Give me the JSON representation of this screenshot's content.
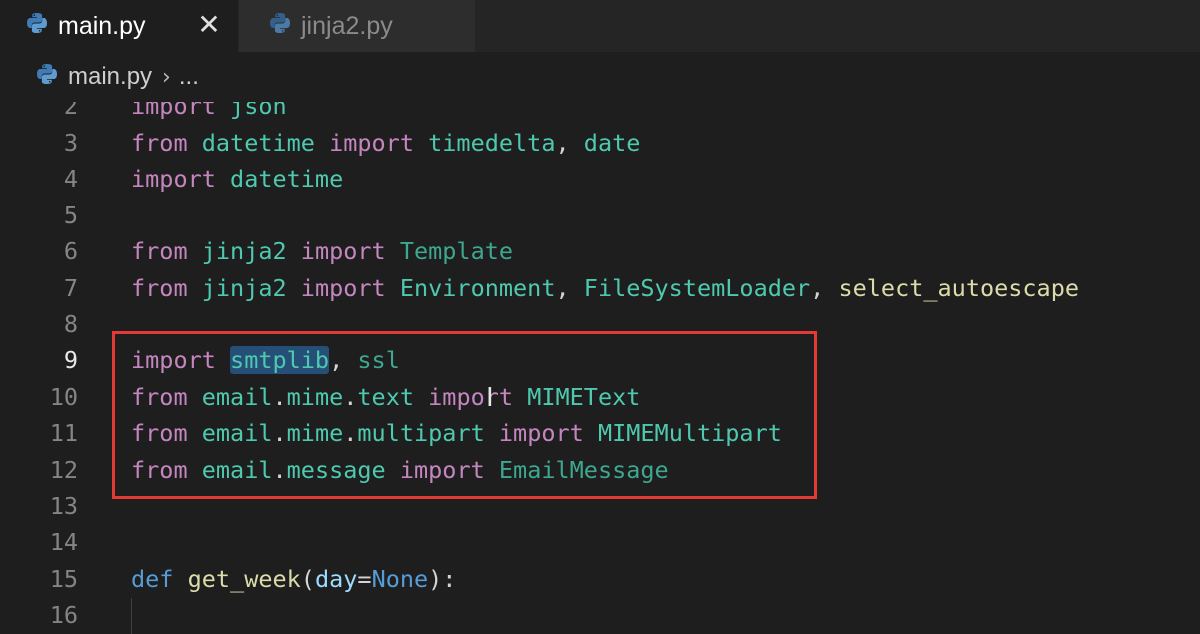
{
  "tabs": [
    {
      "label": "main.py",
      "active": true
    },
    {
      "label": "jinja2.py",
      "active": false
    }
  ],
  "close_glyph": "✕",
  "breadcrumb": {
    "file": "main.py",
    "separator": "›",
    "more": "..."
  },
  "editor": {
    "current_line": "9",
    "line_numbers": [
      "2",
      "3",
      "4",
      "5",
      "6",
      "7",
      "8",
      "9",
      "10",
      "11",
      "12",
      "13",
      "14",
      "15",
      "16"
    ],
    "lines": {
      "l2": {
        "kw": "import",
        "mod": "json"
      },
      "l3": {
        "kw1": "from",
        "mod": "datetime",
        "kw2": "import",
        "a": "timedelta",
        "comma": ",",
        "b": "date"
      },
      "l4": {
        "kw": "import",
        "mod": "datetime"
      },
      "l6": {
        "kw1": "from",
        "mod": "jinja2",
        "kw2": "import",
        "a": "Template"
      },
      "l7": {
        "kw1": "from",
        "mod": "jinja2",
        "kw2": "import",
        "a": "Environment",
        "c1": ",",
        "b": "FileSystemLoader",
        "c2": ",",
        "c": "select_autoescape"
      },
      "l9": {
        "kw": "import",
        "a": "smtplib",
        "comma": ",",
        "b": "ssl"
      },
      "l10": {
        "kw1": "from",
        "m1": "email",
        "d1": ".",
        "m2": "mime",
        "d2": ".",
        "m3": "text",
        "kw2": "import",
        "a": "MIMEText"
      },
      "l11": {
        "kw1": "from",
        "m1": "email",
        "d1": ".",
        "m2": "mime",
        "d2": ".",
        "m3": "multipart",
        "kw2": "import",
        "a": "MIMEMultipart"
      },
      "l12": {
        "kw1": "from",
        "m1": "email",
        "d1": ".",
        "m2": "message",
        "kw2": "import",
        "a": "EmailMessage"
      },
      "l15": {
        "kw": "def",
        "fn": "get_week",
        "p1": "(",
        "param": "day",
        "eq": "=",
        "const": "None",
        "p2": "):"
      }
    }
  },
  "colors": {
    "keyword": "#c586c0",
    "module": "#4ec9b0",
    "function": "#dcdcaa",
    "highlight_box": "#e53935",
    "selection": "#264f78"
  }
}
